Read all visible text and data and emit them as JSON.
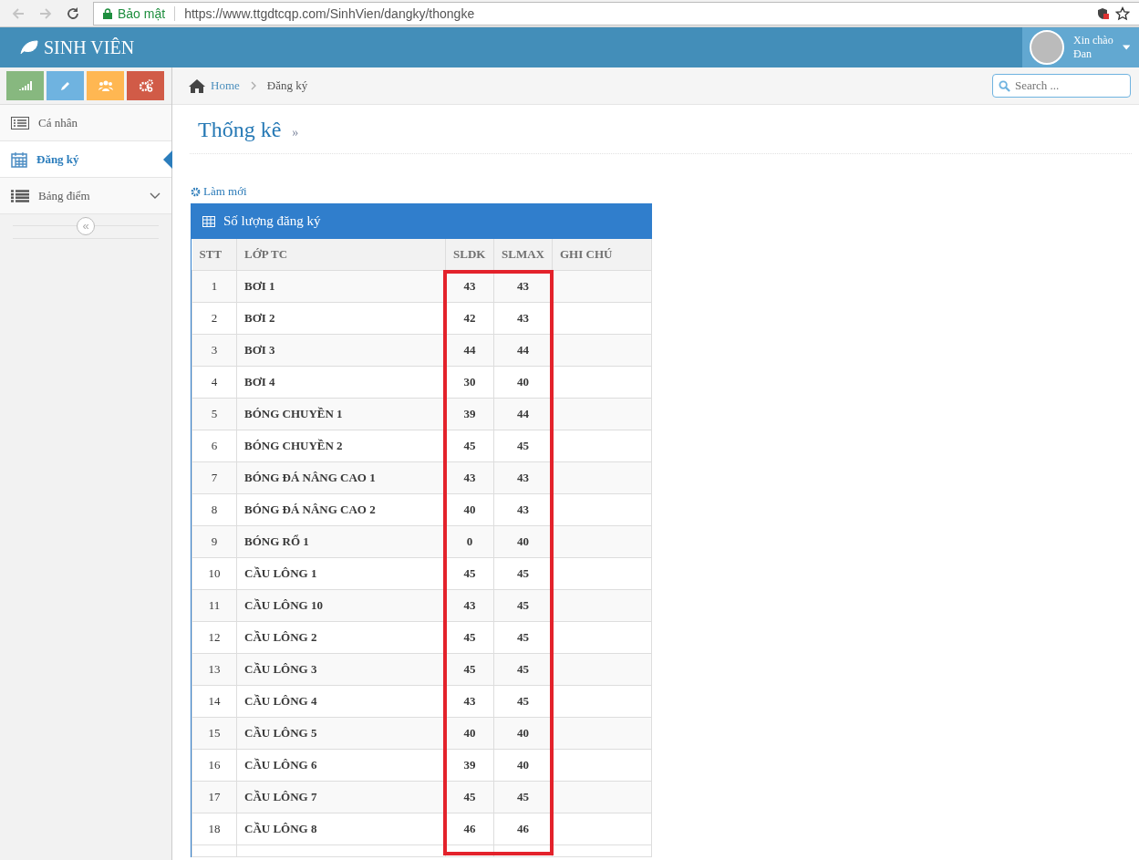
{
  "browser": {
    "security_label": "Bảo mật",
    "url": "https://www.ttgdtcqp.com/SinhVien/dangky/thongke"
  },
  "header": {
    "brand": "SINH VIÊN",
    "greeting": "Xin chào",
    "user_name": "Đan"
  },
  "shortcuts": [
    {
      "kind": "stats",
      "color": "#87b87f"
    },
    {
      "kind": "edit",
      "color": "#6fb3e0"
    },
    {
      "kind": "users",
      "color": "#ffb752"
    },
    {
      "kind": "gears",
      "color": "#d15b47"
    }
  ],
  "sidebar": {
    "items": [
      {
        "label": "Cá nhân",
        "kind": "list-alt",
        "selected": false,
        "has_children": false
      },
      {
        "label": "Đăng ký",
        "kind": "calendar",
        "selected": true,
        "has_children": false
      },
      {
        "label": "Bảng điểm",
        "kind": "list",
        "selected": false,
        "has_children": true
      }
    ],
    "collapse": "«"
  },
  "breadcrumb": [
    {
      "label": "Home",
      "link": true
    },
    {
      "label": "Đăng ký",
      "link": false
    }
  ],
  "search": {
    "placeholder": "Search ..."
  },
  "page_title": "Thống kê",
  "title_suffix": "»",
  "refresh": "Làm mới",
  "table": {
    "title": "Số lượng đăng ký",
    "columns": [
      "STT",
      "LỚP TC",
      "SLDK",
      "SLMAX",
      "GHI CHÚ"
    ],
    "rows": [
      [
        "1",
        "BƠI 1",
        "43",
        "43",
        ""
      ],
      [
        "2",
        "BƠI 2",
        "42",
        "43",
        ""
      ],
      [
        "3",
        "BƠI 3",
        "44",
        "44",
        ""
      ],
      [
        "4",
        "BƠI 4",
        "30",
        "40",
        ""
      ],
      [
        "5",
        "BÓNG CHUYỀN 1",
        "39",
        "44",
        ""
      ],
      [
        "6",
        "BÓNG CHUYỀN 2",
        "45",
        "45",
        ""
      ],
      [
        "7",
        "BÓNG ĐÁ NÂNG CAO 1",
        "43",
        "43",
        ""
      ],
      [
        "8",
        "BÓNG ĐÁ NÂNG CAO 2",
        "40",
        "43",
        ""
      ],
      [
        "9",
        "BÓNG RỔ 1",
        "0",
        "40",
        ""
      ],
      [
        "10",
        "CẦU LÔNG 1",
        "45",
        "45",
        ""
      ],
      [
        "11",
        "CẦU LÔNG 10",
        "43",
        "45",
        ""
      ],
      [
        "12",
        "CẦU LÔNG 2",
        "45",
        "45",
        ""
      ],
      [
        "13",
        "CẦU LÔNG 3",
        "45",
        "45",
        ""
      ],
      [
        "14",
        "CẦU LÔNG 4",
        "43",
        "45",
        ""
      ],
      [
        "15",
        "CẦU LÔNG 5",
        "40",
        "40",
        ""
      ],
      [
        "16",
        "CẦU LÔNG 6",
        "39",
        "40",
        ""
      ],
      [
        "17",
        "CẦU LÔNG 7",
        "45",
        "45",
        ""
      ],
      [
        "18",
        "CẦU LÔNG 8",
        "46",
        "46",
        ""
      ]
    ]
  }
}
